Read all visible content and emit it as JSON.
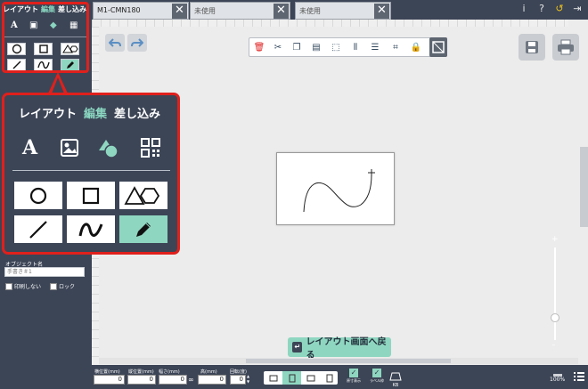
{
  "tabs": [
    {
      "label": "M1-CMN180",
      "active": true
    },
    {
      "label": "未使用",
      "active": false
    },
    {
      "label": "未使用",
      "active": false
    }
  ],
  "header": {
    "info_icon": "i",
    "help_icon": "?",
    "undo_icon": "↺",
    "exit_icon": "⇥"
  },
  "sidebar": {
    "tabs": [
      {
        "label": "レイアウト",
        "selected": false
      },
      {
        "label": "編集",
        "selected": true
      },
      {
        "label": "差し込み",
        "selected": false
      }
    ],
    "object_name_label": "オブジェクト名",
    "object_name_value": "手書き＃1",
    "no_print_label": "印刷しない",
    "lock_label": "ロック"
  },
  "callout": {
    "tabs": [
      {
        "label": "レイアウト",
        "selected": false
      },
      {
        "label": "編集",
        "selected": true
      },
      {
        "label": "差し込み",
        "selected": false
      }
    ],
    "selected_tool": "pencil-icon"
  },
  "toolbar": {
    "icons": [
      "delete-icon",
      "cut-icon",
      "copy-icon",
      "paste-icon",
      "select-region-icon",
      "align-icon",
      "layers-icon",
      "edit-points-icon",
      "lock-icon"
    ]
  },
  "canvas": {
    "back_button_label": "レイアウト画面へ戻る"
  },
  "bottom": {
    "fields": [
      {
        "label": "横位置(mm)",
        "value": "0"
      },
      {
        "label": "縦位置(mm)",
        "value": "0"
      },
      {
        "label": "幅さ(mm)",
        "value": "0"
      },
      {
        "label": "高(mm)",
        "value": "0"
      },
      {
        "label": "回転(度)",
        "value": "0"
      }
    ],
    "checks": [
      {
        "label": "原寸表示"
      },
      {
        "label": "ラベル枠"
      }
    ],
    "kb_label": "KB",
    "zoom_label": "100%"
  },
  "colors": {
    "accent": "#8fd6c0",
    "panel": "#3c4556",
    "highlight": "#e0201c",
    "delete": "#e02020"
  }
}
